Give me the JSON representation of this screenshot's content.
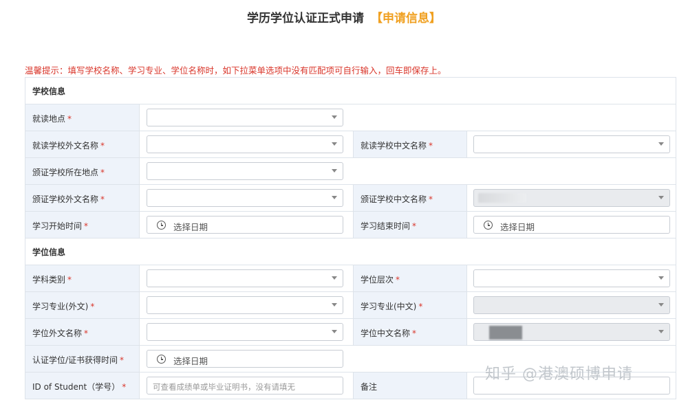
{
  "page": {
    "title": "学历学位认证正式申请",
    "title_tag": "【申请信息】",
    "warning": "温馨提示：填写学校名称、学习专业、学位名称时，如下拉菜单选项中没有匹配项可自行输入，回车即保存上。"
  },
  "sections": {
    "school": "学校信息",
    "degree": "学位信息"
  },
  "fields": {
    "study_location": "就读地点",
    "school_foreign_name": "就读学校外文名称",
    "school_chinese_name": "就读学校中文名称",
    "issuer_location": "颁证学校所在地点",
    "issuer_foreign_name": "颁证学校外文名称",
    "issuer_chinese_name": "颁证学校中文名称",
    "study_start": "学习开始时间",
    "study_end": "学习结束时间",
    "subject_category": "学科类别",
    "degree_level": "学位层次",
    "major_foreign": "学习专业(外文)",
    "major_chinese": "学习专业(中文)",
    "degree_foreign_name": "学位外文名称",
    "degree_chinese_name": "学位中文名称",
    "cert_time": "认证学位/证书获得时间",
    "student_id": "ID of Student（学号）",
    "remarks": "备注"
  },
  "required_mark": "*",
  "placeholders": {
    "date": "选择日期",
    "student_id": "可查看成绩单或毕业证明书，没有请填无"
  },
  "watermark": "知乎 @港澳硕博申请",
  "colors": {
    "required": "#d9362b",
    "tag": "#f0a020",
    "label_bg": "#eef3fa"
  }
}
